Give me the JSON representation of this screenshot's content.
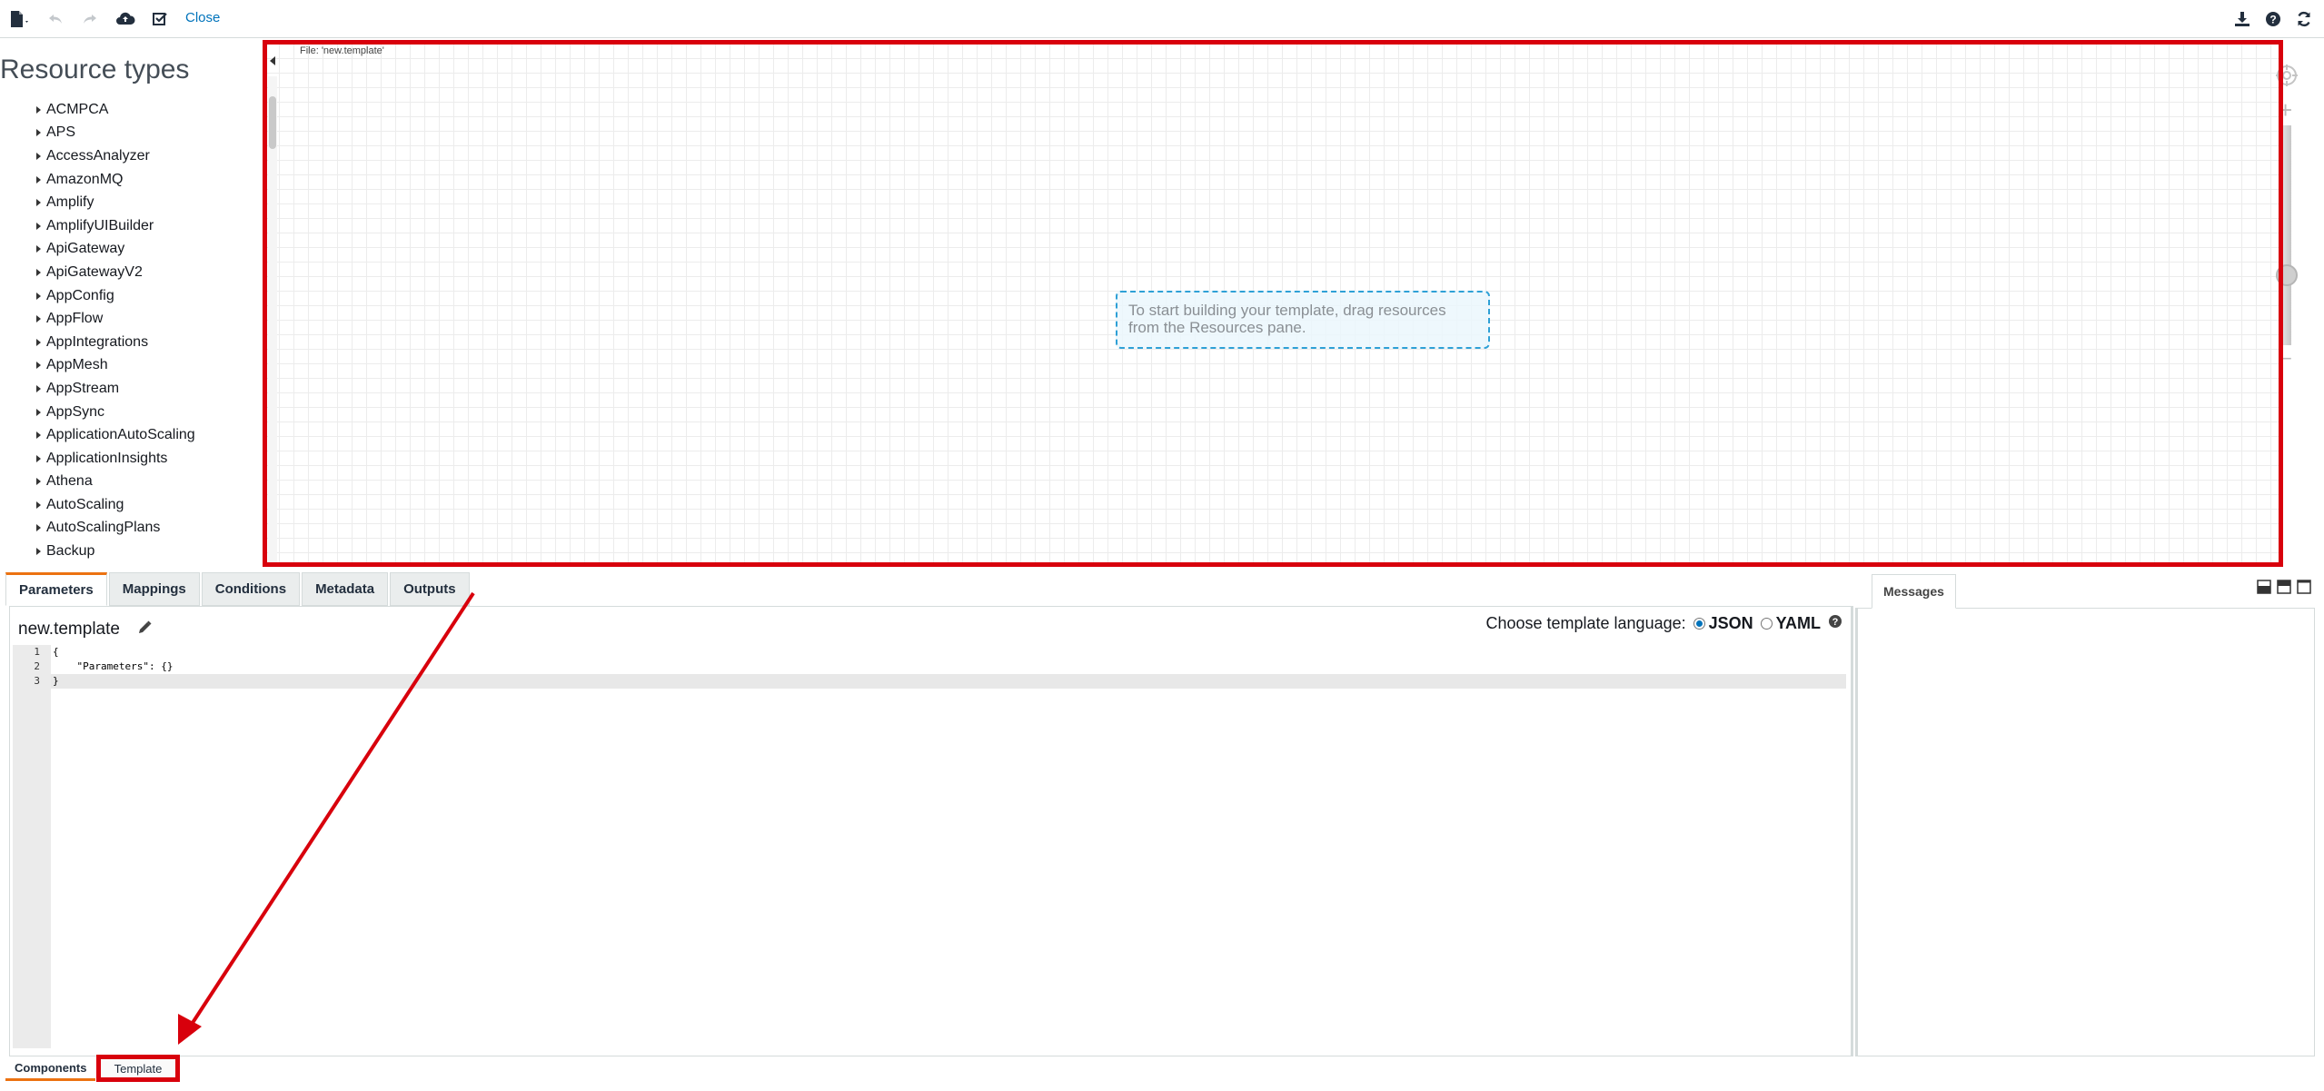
{
  "toolbar": {
    "close_label": "Close"
  },
  "left_panel": {
    "title": "Resource types",
    "resource_types": [
      "ACMPCA",
      "APS",
      "AccessAnalyzer",
      "AmazonMQ",
      "Amplify",
      "AmplifyUIBuilder",
      "ApiGateway",
      "ApiGatewayV2",
      "AppConfig",
      "AppFlow",
      "AppIntegrations",
      "AppMesh",
      "AppStream",
      "AppSync",
      "ApplicationAutoScaling",
      "ApplicationInsights",
      "Athena",
      "AutoScaling",
      "AutoScalingPlans",
      "Backup"
    ]
  },
  "canvas": {
    "file_label": "File: 'new.template'",
    "hint_text": "To start building your template, drag resources from the Resources pane."
  },
  "editor_pane": {
    "tabs": [
      "Parameters",
      "Mappings",
      "Conditions",
      "Metadata",
      "Outputs"
    ],
    "active_tab": "Parameters",
    "template_name": "new.template",
    "language_prompt": "Choose template language:",
    "language_options": [
      "JSON",
      "YAML"
    ],
    "selected_language": "JSON",
    "code_lines": [
      {
        "num": "1",
        "text": "{"
      },
      {
        "num": "2",
        "text": "    \"Parameters\": {}"
      },
      {
        "num": "3",
        "text": "}"
      }
    ]
  },
  "messages_pane": {
    "tab_label": "Messages"
  },
  "bottom_tabs": {
    "components_label": "Components",
    "template_label": "Template"
  },
  "colors": {
    "highlight_red": "#d8000c",
    "link_blue": "#0073bb",
    "active_tab_orange": "#ec7211",
    "hint_border": "#2ea0d6"
  }
}
